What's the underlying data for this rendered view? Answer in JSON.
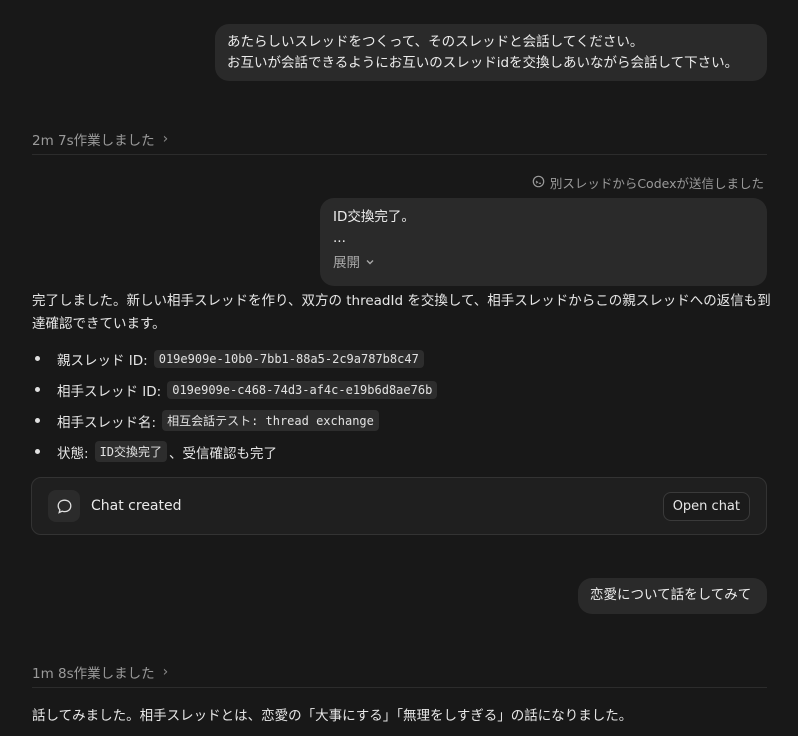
{
  "user_message_1": {
    "line1": "あたらしいスレッドをつくって、そのスレッドと会話してください。",
    "line2": "お互いが会話できるようにお互いのスレッドidを交換しあいながら会話して下さい。"
  },
  "work_1": {
    "label": "2m 7s作業しました"
  },
  "sent_notice": {
    "label": "別スレッドからCodexが送信しました"
  },
  "forwarded_message": {
    "line1": "ID交換完了。",
    "line2": "...",
    "expand_label": "展開"
  },
  "assistant_reply": {
    "text": "完了しました。新しい相手スレッドを作り、双方の threadId を交換して、相手スレッドからこの親スレッドへの返信も到達確認できています。",
    "items": [
      {
        "label": "親スレッド ID: ",
        "code": "019e909e-10b0-7bb1-88a5-2c9a787b8c47",
        "suffix": ""
      },
      {
        "label": "相手スレッド ID: ",
        "code": "019e909e-c468-74d3-af4c-e19b6d8ae76b",
        "suffix": ""
      },
      {
        "label": "相手スレッド名: ",
        "code": "相互会話テスト: thread exchange",
        "suffix": ""
      },
      {
        "label": "状態: ",
        "code": "ID交換完了",
        "suffix": "、受信確認も完了"
      }
    ]
  },
  "chat_card": {
    "title": "Chat created",
    "button_label": "Open chat",
    "icon": "chat-bubble-icon"
  },
  "user_message_2": {
    "text": "恋愛について話をしてみて"
  },
  "work_2": {
    "label": "1m 8s作業しました"
  },
  "final_reply": {
    "text": "話してみました。相手スレッドとは、恋愛の「大事にする」「無理をしすぎる」の話になりました。"
  },
  "colors": {
    "background": "#181818",
    "bubble": "#2a2a2a",
    "muted_text": "#9a9a9a"
  }
}
